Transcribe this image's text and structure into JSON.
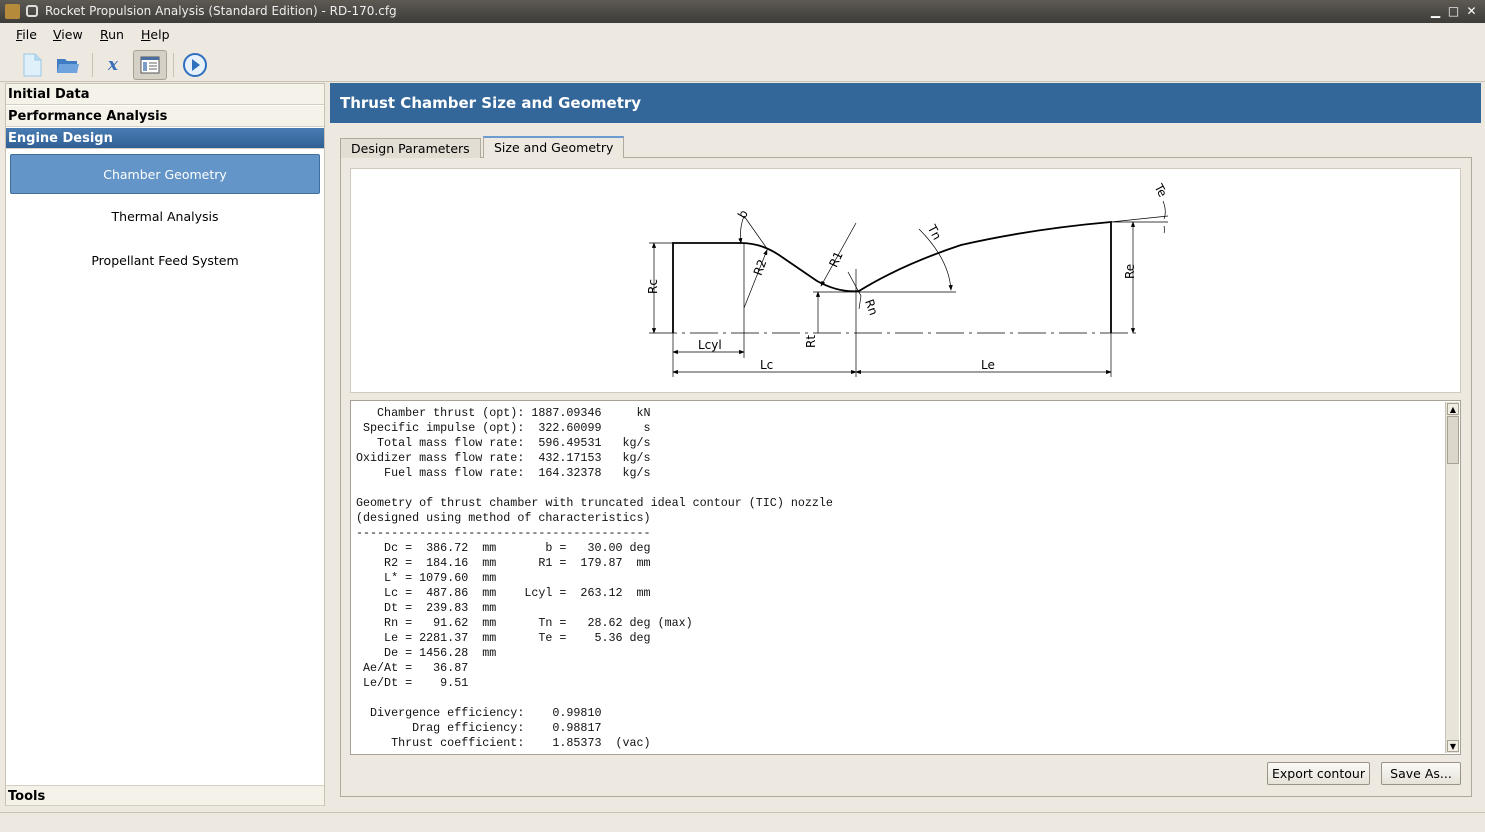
{
  "window": {
    "title": "Rocket Propulsion Analysis (Standard Edition) - RD-170.cfg",
    "minimize": "▁",
    "maximize": "□",
    "close": "✕"
  },
  "menu": [
    {
      "label": "File",
      "key": "F",
      "rest": "ile"
    },
    {
      "label": "View",
      "key": "V",
      "rest": "iew"
    },
    {
      "label": "Run",
      "key": "R",
      "rest": "un"
    },
    {
      "label": "Help",
      "key": "H",
      "rest": "elp"
    }
  ],
  "toolbar": {
    "items": [
      "new-file-icon",
      "open-folder-icon",
      "formula-icon",
      "report-view-icon",
      "run-icon"
    ]
  },
  "sidebar": {
    "sections": [
      "Initial Data",
      "Performance Analysis",
      "Engine Design",
      "Tools"
    ],
    "items": [
      "Chamber Geometry",
      "Thermal Analysis",
      "Propellant Feed System"
    ],
    "selected_item": "Chamber Geometry"
  },
  "header": {
    "title": "Thrust Chamber Size and Geometry"
  },
  "tabs": [
    {
      "label": "Design Parameters"
    },
    {
      "label": "Size and Geometry",
      "selected": true
    }
  ],
  "diagram": {
    "labels": {
      "b": "b",
      "R2": "R2",
      "R1": "R1",
      "Tn": "Tn",
      "Te": "Te",
      "Rc": "Rc",
      "Rt": "Rt",
      "Rn": "Rn",
      "Re": "Re",
      "Lcyl": "Lcyl",
      "Lc": "Lc",
      "Le": "Le"
    }
  },
  "output": {
    "lines": [
      "",
      "   Chamber thrust (opt): 1887.09346     kN",
      " Specific impulse (opt):  322.60099      s",
      "   Total mass flow rate:  596.49531   kg/s",
      "Oxidizer mass flow rate:  432.17153   kg/s",
      "    Fuel mass flow rate:  164.32378   kg/s",
      "",
      "Geometry of thrust chamber with truncated ideal contour (TIC) nozzle",
      "(designed using method of characteristics)",
      "------------------------------------------",
      "    Dc =  386.72  mm       b =   30.00 deg",
      "    R2 =  184.16  mm      R1 =  179.87  mm",
      "    L* = 1079.60  mm",
      "    Lc =  487.86  mm    Lcyl =  263.12  mm",
      "    Dt =  239.83  mm",
      "    Rn =   91.62  mm      Tn =   28.62 deg (max)",
      "    Le = 2281.37  mm      Te =    5.36 deg",
      "    De = 1456.28  mm",
      " Ae/At =   36.87",
      " Le/Dt =    9.51",
      "",
      "  Divergence efficiency:    0.99810",
      "        Drag efficiency:    0.98817",
      "     Thrust coefficient:    1.85373  (vac)"
    ],
    "scroll_position": 0.05
  },
  "buttons": {
    "export": "Export contour",
    "save": "Save As..."
  },
  "colors": {
    "accent": "#336699",
    "selected_item": "#6495c8"
  }
}
